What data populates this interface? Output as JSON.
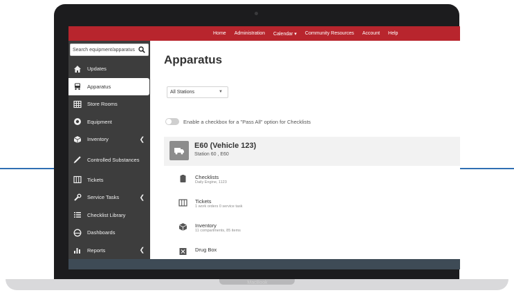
{
  "device": {
    "brand": "MacBook"
  },
  "topnav": {
    "items": [
      "Home",
      "Administration",
      "Calendar ▾",
      "Community Resources",
      "Account",
      "Help"
    ]
  },
  "sidebar": {
    "search_placeholder": "Search equipment/apparatus",
    "items": [
      {
        "label": "Updates",
        "icon": "home-icon"
      },
      {
        "label": "Apparatus",
        "icon": "truck-icon",
        "active": true
      },
      {
        "label": "Store Rooms",
        "icon": "grid-icon"
      },
      {
        "label": "Equipment",
        "icon": "target-icon"
      },
      {
        "label": "Inventory",
        "icon": "box-icon",
        "chevron": true
      },
      {
        "label": "Controlled Substances",
        "icon": "syringe-icon"
      },
      {
        "label": "Tickets",
        "icon": "columns-icon"
      },
      {
        "label": "Service Tasks",
        "icon": "wrench-icon",
        "chevron": true
      },
      {
        "label": "Checklist Library",
        "icon": "list-icon"
      },
      {
        "label": "Dashboards",
        "icon": "gauge-icon"
      },
      {
        "label": "Reports",
        "icon": "bar-chart-icon",
        "chevron": true
      }
    ]
  },
  "main": {
    "title": "Apparatus",
    "station_filter": "All Stations",
    "pass_all_toggle_label": "Enable a checkbox for a \"Pass All\" option for Checklists",
    "vehicle": {
      "name": "E60 (Vehicle 123)",
      "subtitle": "Station 60 , E60"
    },
    "sections": [
      {
        "title": "Checklists",
        "subtitle": "Daily Engine, 1123",
        "icon": "clipboard-icon"
      },
      {
        "title": "Tickets",
        "subtitle": "1 work orders 0 service task",
        "icon": "columns-icon"
      },
      {
        "title": "Inventory",
        "subtitle": "11 compartments, 85 items",
        "icon": "box-icon"
      },
      {
        "title": "Drug Box",
        "subtitle": "",
        "icon": "medkit-icon"
      }
    ]
  },
  "colors": {
    "topbar": "#b8252d",
    "sidebar": "#3d3d3d",
    "accent_line": "#2f6fb3"
  }
}
